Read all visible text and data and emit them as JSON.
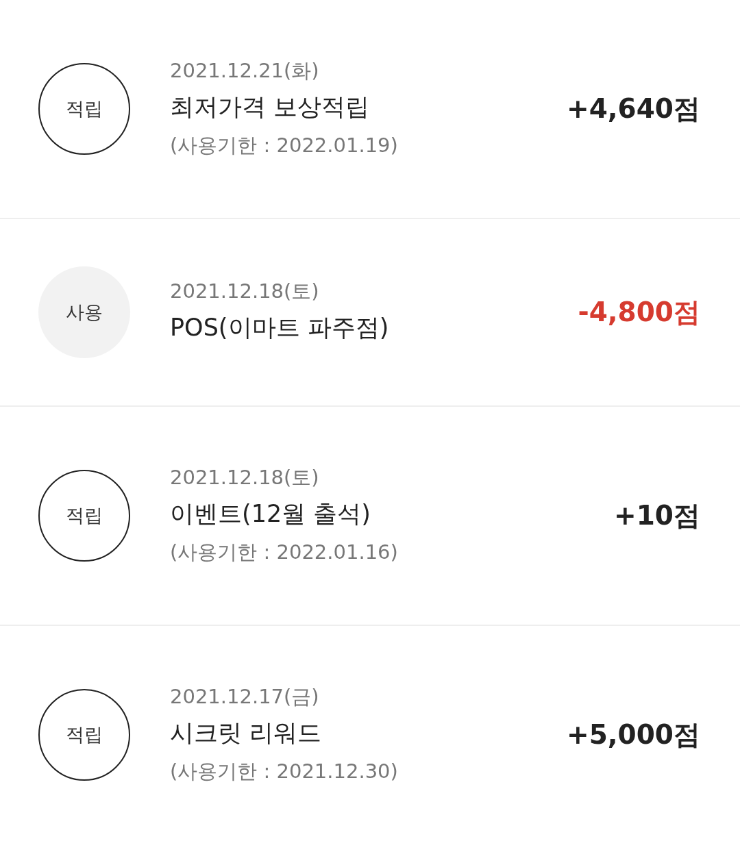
{
  "history": [
    {
      "kind": "earn",
      "badge": "적립",
      "date": "2021.12.21(화)",
      "title": "최저가격 보상적립",
      "expiry": "(사용기한 : 2022.01.19)",
      "amount": "+4,640점"
    },
    {
      "kind": "use",
      "badge": "사용",
      "date": "2021.12.18(토)",
      "title": "POS(이마트 파주점)",
      "amount": "-4,800점"
    },
    {
      "kind": "earn",
      "badge": "적립",
      "date": "2021.12.18(토)",
      "title": "이벤트(12월 출석)",
      "expiry": "(사용기한 : 2022.01.16)",
      "amount": "+10점"
    },
    {
      "kind": "earn",
      "badge": "적립",
      "date": "2021.12.17(금)",
      "title": "시크릿 리워드",
      "expiry": "(사용기한 : 2021.12.30)",
      "amount": "+5,000점"
    }
  ]
}
